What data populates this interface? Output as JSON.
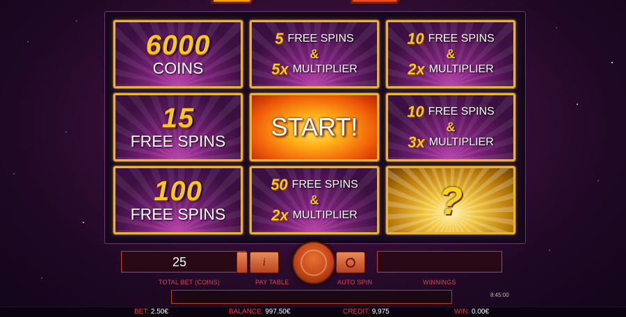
{
  "board": {
    "tiles": [
      {
        "big": "6000",
        "sub": "COINS"
      },
      {
        "spins_num": "5",
        "spins_label": "FREE SPINS",
        "amp": "&",
        "mult_num": "5x",
        "mult_label": "MULTIPLIER"
      },
      {
        "spins_num": "10",
        "spins_label": "FREE SPINS",
        "amp": "&",
        "mult_num": "2x",
        "mult_label": "MULTIPLIER"
      },
      {
        "big": "15",
        "sub": "FREE SPINS"
      },
      {
        "label": "START!"
      },
      {
        "spins_num": "10",
        "spins_label": "FREE SPINS",
        "amp": "&",
        "mult_num": "3x",
        "mult_label": "MULTIPLIER"
      },
      {
        "big": "100",
        "sub": "FREE SPINS"
      },
      {
        "spins_num": "50",
        "spins_label": "FREE SPINS",
        "amp": "&",
        "mult_num": "2x",
        "mult_label": "MULTIPLIER"
      },
      {
        "symbol": "?"
      }
    ]
  },
  "controls": {
    "total_bet_value": "25",
    "total_bet_label": "TOTAL BET (COINS)",
    "pay_table_label": "PAY TABLE",
    "pay_table_icon": "i",
    "auto_spin_label": "AUTO SPIN",
    "winnings_label": "WINNINGS",
    "winnings_value": ""
  },
  "clock": "8:45:00",
  "status": {
    "bet_label": "BET:",
    "bet_value": "2.50€",
    "balance_label": "BALANCE:",
    "balance_value": "997.50€",
    "credit_label": "CREDIT:",
    "credit_value": "9,975",
    "win_label": "WIN:",
    "win_value": "0.00€"
  },
  "colors": {
    "gold": "#e6b437",
    "accent_red": "#d23a1c",
    "caption": "#d8465a"
  }
}
